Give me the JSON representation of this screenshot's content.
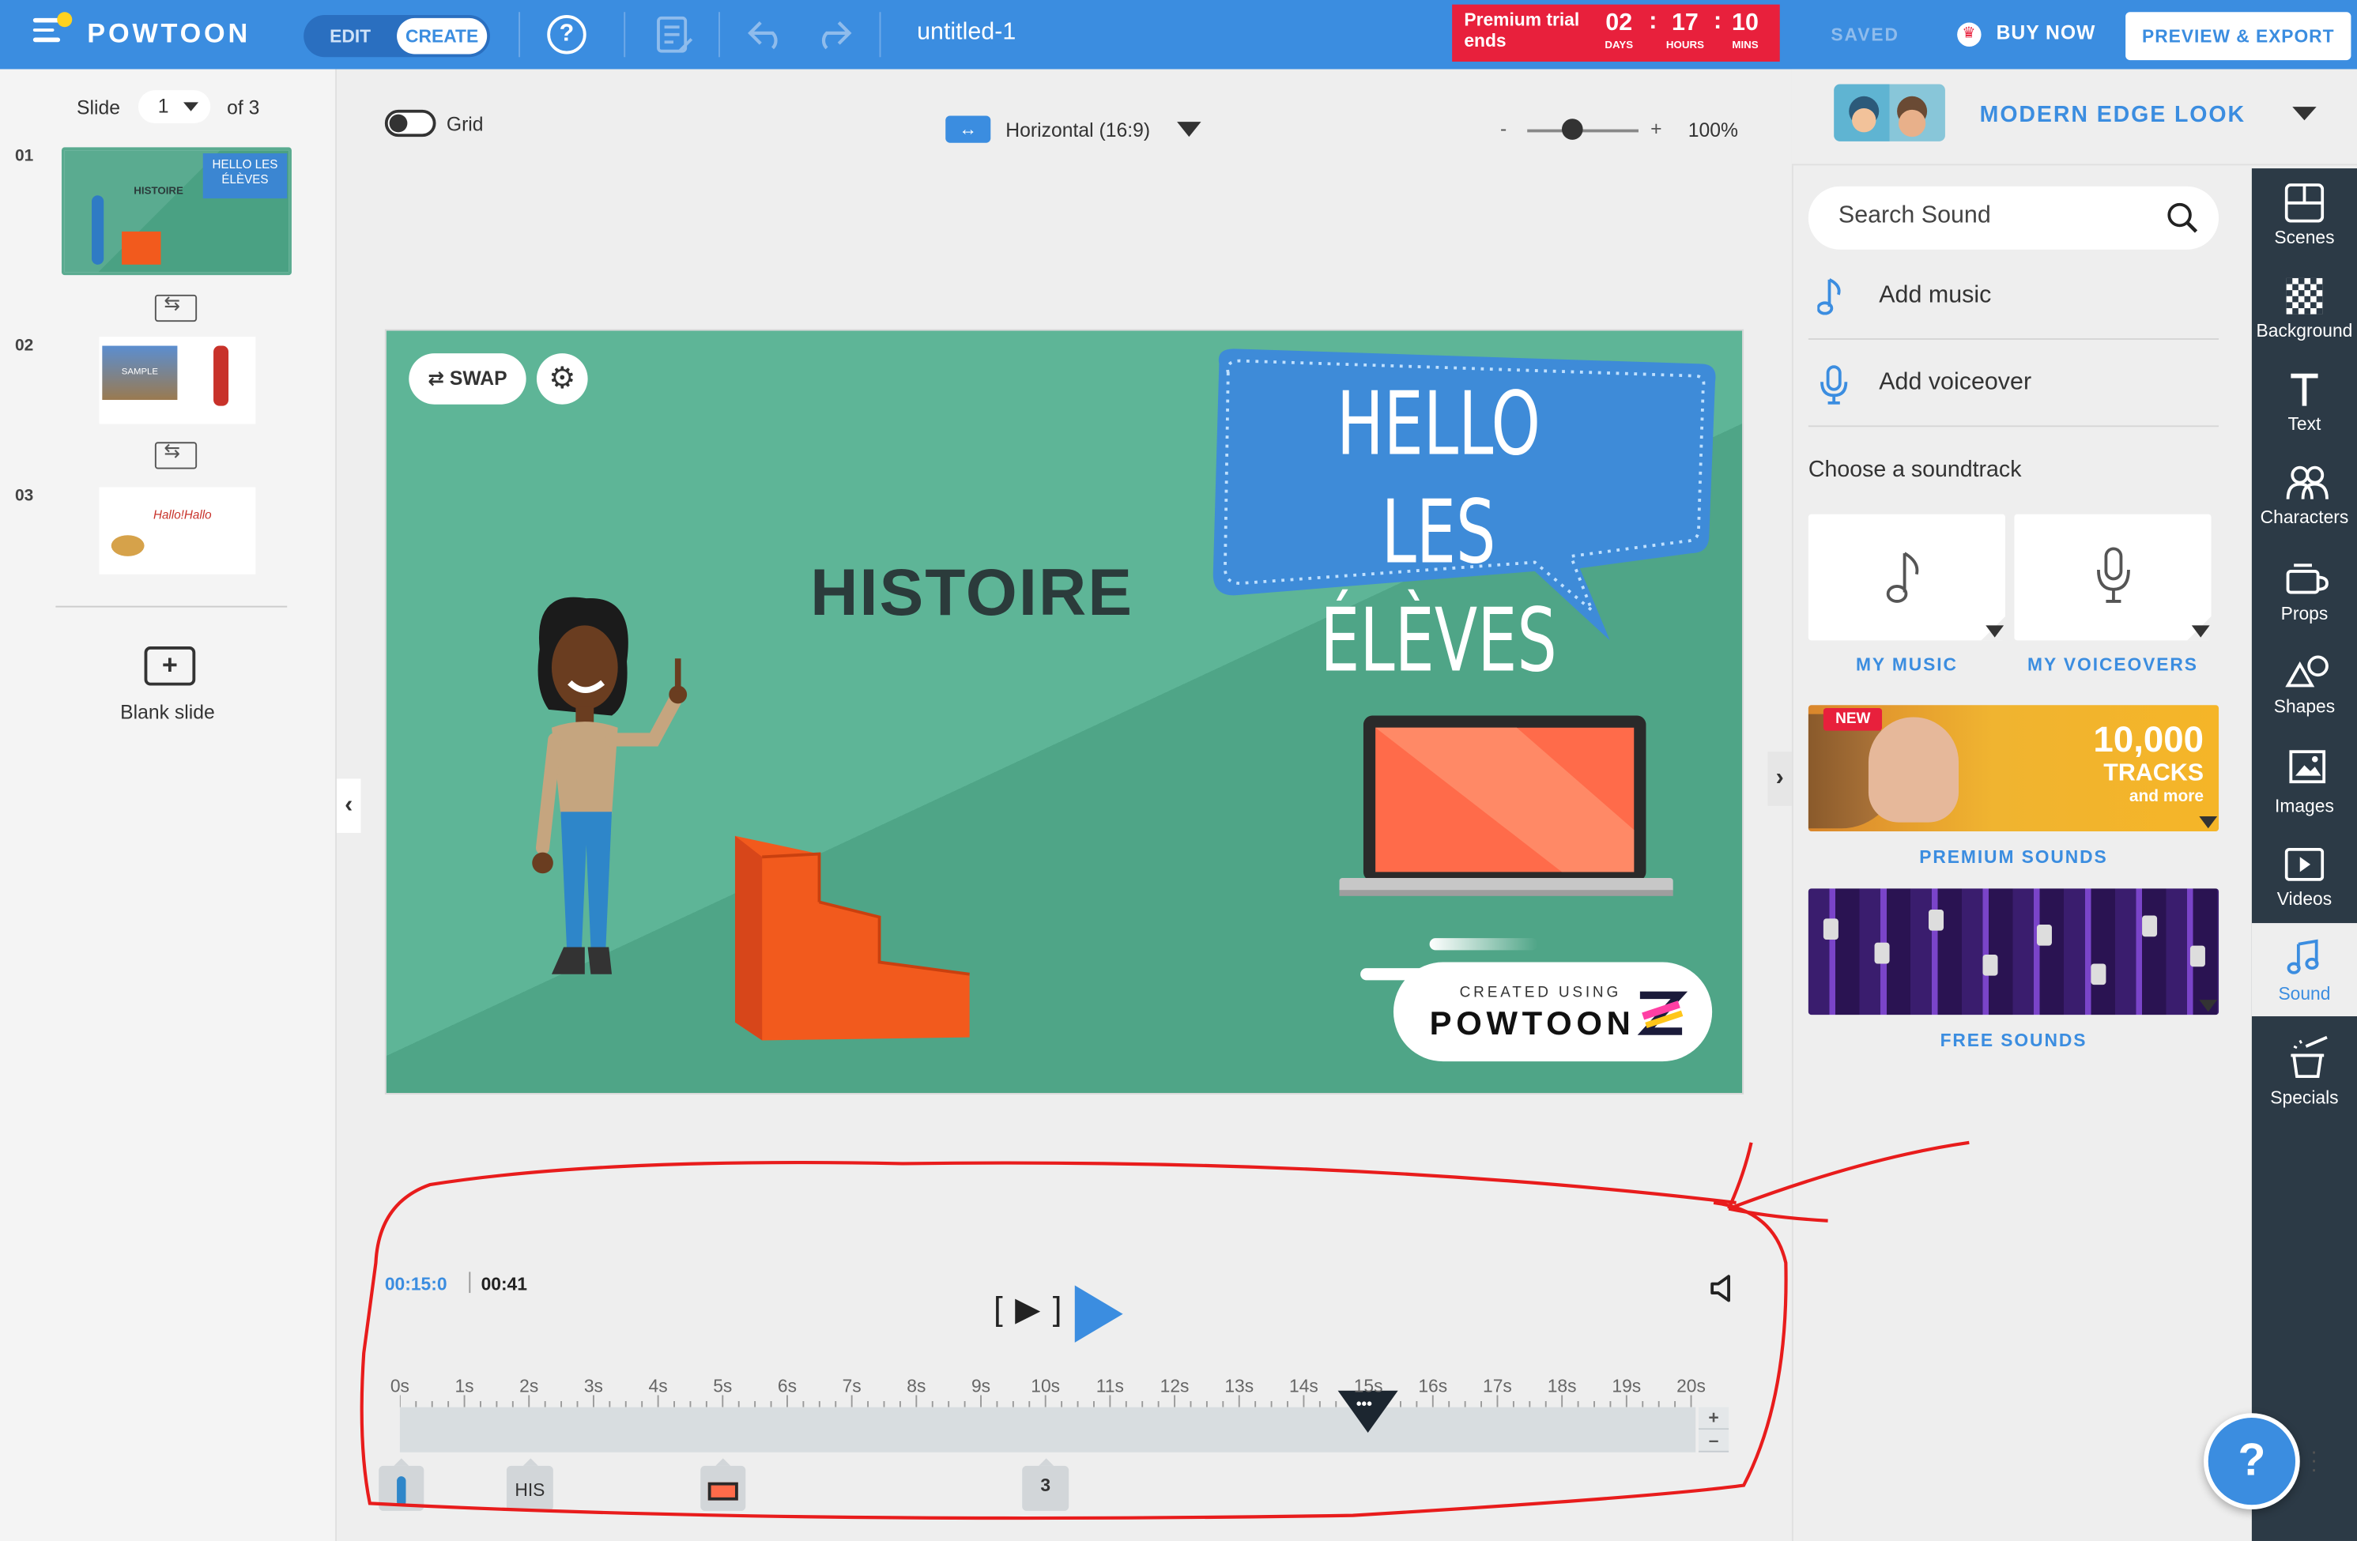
{
  "app": {
    "logo": "POWTOON",
    "mode_edit": "EDIT",
    "mode_create": "CREATE",
    "doc_title": "untitled-1",
    "trial_label": "Premium trial ends",
    "trial_days": "02",
    "trial_hours": "17",
    "trial_mins": "10",
    "trial_days_unit": "DAYS",
    "trial_hours_unit": "HOURS",
    "trial_mins_unit": "MINS",
    "saved": "SAVED",
    "buy_now": "BUY NOW",
    "preview_export": "PREVIEW & EXPORT"
  },
  "slides_panel": {
    "slide_word": "Slide",
    "current": "1",
    "of_total": "of 3",
    "numbers": [
      "01",
      "02",
      "03"
    ],
    "thumb1_text_a": "HISTOIRE",
    "thumb1_text_b": "HELLO LES ÉLÈVES",
    "thumb2_text": "SAMPLE",
    "thumb3_text": "Hallo!Hallo",
    "blank_slide": "Blank slide"
  },
  "canvas_toolbar": {
    "grid": "Grid",
    "orientation": "Horizontal (16:9)",
    "zoom_minus": "-",
    "zoom_plus": "+",
    "zoom": "100%",
    "zoom_level_fraction": 0.4
  },
  "canvas": {
    "swap": "SWAP",
    "histoire": "HISTOIRE",
    "bubble_line1": "HELLO LES",
    "bubble_line2": "ÉLÈVES",
    "watermark_small": "CREATED USING",
    "watermark_big": "POWTOON"
  },
  "timeline": {
    "current_time": "00:15:0",
    "total_time": "00:41",
    "play_frame": "[ ▶ ]",
    "ticks": [
      "0s",
      "1s",
      "2s",
      "3s",
      "4s",
      "5s",
      "6s",
      "7s",
      "8s",
      "9s",
      "10s",
      "11s",
      "12s",
      "13s",
      "14s",
      "15s",
      "16s",
      "17s",
      "18s",
      "19s",
      "20s"
    ],
    "playhead_seconds": 15,
    "playhead_dots": "•••",
    "zoom_in": "+",
    "zoom_out": "–",
    "markers": [
      {
        "label": "",
        "kind": "character"
      },
      {
        "label": "HIS",
        "kind": "text"
      },
      {
        "label": "",
        "kind": "laptop"
      },
      {
        "label": "3",
        "kind": "group"
      }
    ]
  },
  "right_panel": {
    "style_name": "MODERN EDGE LOOK",
    "search_placeholder": "Search Sound",
    "add_music": "Add music",
    "add_voiceover": "Add voiceover",
    "choose_soundtrack": "Choose a soundtrack",
    "my_music": "MY MUSIC",
    "my_voiceovers": "MY VOICEOVERS",
    "new_badge": "NEW",
    "prem_big": "10,000",
    "prem_mid": "TRACKS",
    "prem_small": "and more",
    "premium_sounds": "PREMIUM SOUNDS",
    "free_sounds": "FREE SOUNDS"
  },
  "iconbar": {
    "items": [
      "Scenes",
      "Background",
      "Text",
      "Characters",
      "Props",
      "Shapes",
      "Images",
      "Videos",
      "Sound",
      "Specials"
    ],
    "active": "Sound"
  },
  "help_float": "?",
  "colors": {
    "brand_blue": "#3b8de0",
    "trial_red": "#e8203c",
    "canvas_green": "#5eb597",
    "sidebar_dark": "#2c3a46",
    "annotation_red": "#e81c1c"
  }
}
